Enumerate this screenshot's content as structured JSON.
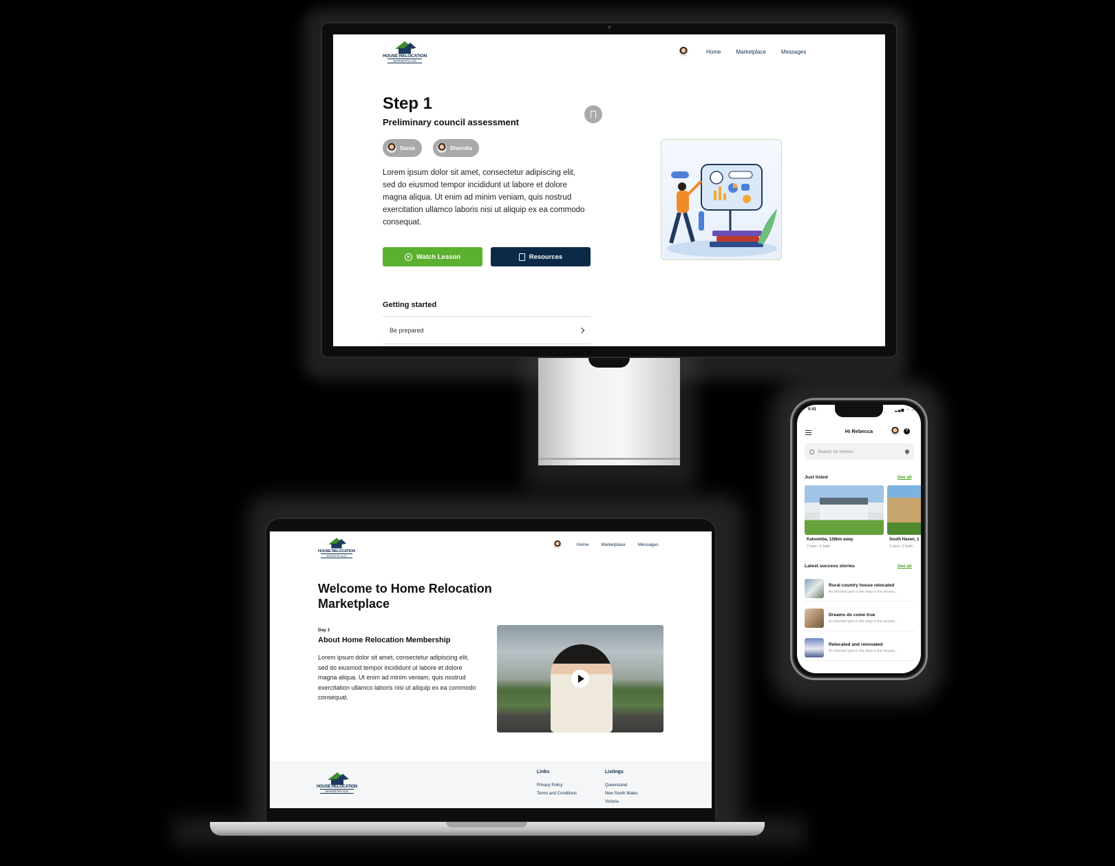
{
  "brand": {
    "logo_line1": "HOUSE RELOCATION",
    "logo_line2": "MARKETPLACE"
  },
  "nav": {
    "home": "Home",
    "marketplace": "Marketplace",
    "messages": "Messages"
  },
  "monitor": {
    "step": "Step 1",
    "subtitle": "Preliminary council assessment",
    "chips": [
      "Sonia",
      "Shernita"
    ],
    "body": "Lorem ipsum dolor sit amet, consectetur adipiscing elit, sed do eiusmod tempor incididunt ut labore et dolore magna aliqua. Ut enim ad minim veniam, quis nostrud exercitation ullamco laboris nisi ut aliquip ex ea commodo consequat.",
    "watch_label": "Watch Lesson",
    "resources_label": "Resources",
    "section_title": "Getting started",
    "list_item": "Be prepared"
  },
  "laptop": {
    "title": "Welcome to Home Relocation Marketplace",
    "day": "Day 1",
    "about": "About Home Relocation Membership",
    "body": "Lorem ipsum dolor sit amet, consectetur adipiscing elit, sed do eiusmod tempor incididunt ut labore et dolore magna aliqua. Ut enim ad minim veniam, quis nostrud exercitation ullamco laboris nisi ut aliquip ex ea commodo consequat.",
    "footer": {
      "links_heading": "Links",
      "links": [
        "Privacy Policy",
        "Terms and Conditions"
      ],
      "listings_heading": "Listings",
      "listings": [
        "Queensland",
        "New South Wales",
        "Victoria"
      ]
    }
  },
  "phone": {
    "time": "9:41",
    "greeting": "Hi Rebecca",
    "help": "?",
    "search_placeholder": "Search for homes",
    "just_listed": "Just listed",
    "see_all": "See all",
    "listings": [
      {
        "title": "Katoomba, 128km away",
        "meta": "3 bed  •  2 bath"
      },
      {
        "title": "South Haven, 1",
        "meta": "3 bed  •  2 bath"
      }
    ],
    "stories_heading": "Latest success stories",
    "stories": [
      {
        "title": "Rural country house relocated",
        "desc": "An inherited gem in the deep in the mounta..."
      },
      {
        "title": "Dreams do come true",
        "desc": "An inherited gem in the deep in the mounta..."
      },
      {
        "title": "Relocated and renovated",
        "desc": "An inherited gem in the deep in the mounta..."
      }
    ]
  },
  "colors": {
    "green": "#5bb12f",
    "navy": "#0c2a48",
    "link_green": "#4aa420"
  }
}
